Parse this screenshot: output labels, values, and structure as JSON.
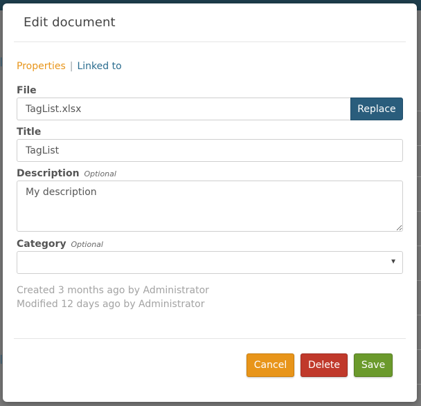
{
  "modal": {
    "title": "Edit document"
  },
  "tabs": {
    "active_label": "Properties",
    "separator": "|",
    "other_label": "Linked to"
  },
  "fields": {
    "file": {
      "label": "File",
      "value": "TagList.xlsx",
      "button_label": "Replace"
    },
    "title": {
      "label": "Title",
      "value": "TagList"
    },
    "description": {
      "label": "Description",
      "optional": "Optional",
      "value": "My description"
    },
    "category": {
      "label": "Category",
      "optional": "Optional",
      "value": ""
    }
  },
  "meta": {
    "created": "Created 3 months ago by Administrator",
    "modified": "Modified 12 days ago by Administrator"
  },
  "footer": {
    "cancel_label": "Cancel",
    "delete_label": "Delete",
    "save_label": "Save"
  },
  "colors": {
    "primary": "#2a5d7c",
    "warning": "#e8951a",
    "danger": "#c0392b",
    "success": "#6b9a2c"
  }
}
